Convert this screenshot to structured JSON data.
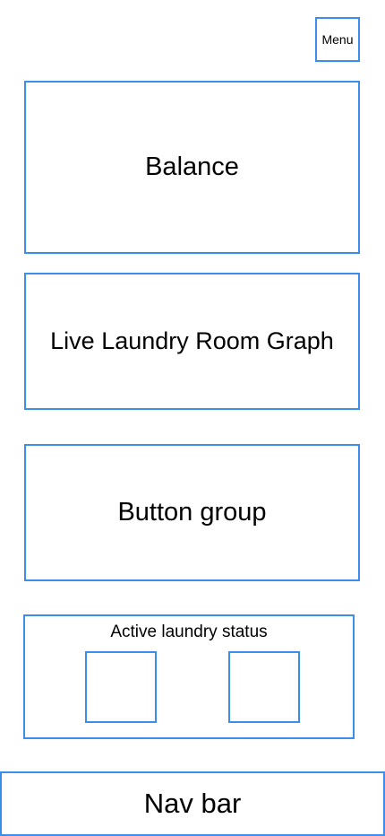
{
  "header": {
    "menu_label": "Menu"
  },
  "cards": {
    "balance_label": "Balance",
    "graph_label": "Live Laundry Room Graph",
    "button_group_label": "Button group"
  },
  "status": {
    "title": "Active laundry status"
  },
  "nav": {
    "label": "Nav bar"
  },
  "colors": {
    "border": "#3b8eea",
    "background": "#ffffff",
    "text": "#000000"
  }
}
